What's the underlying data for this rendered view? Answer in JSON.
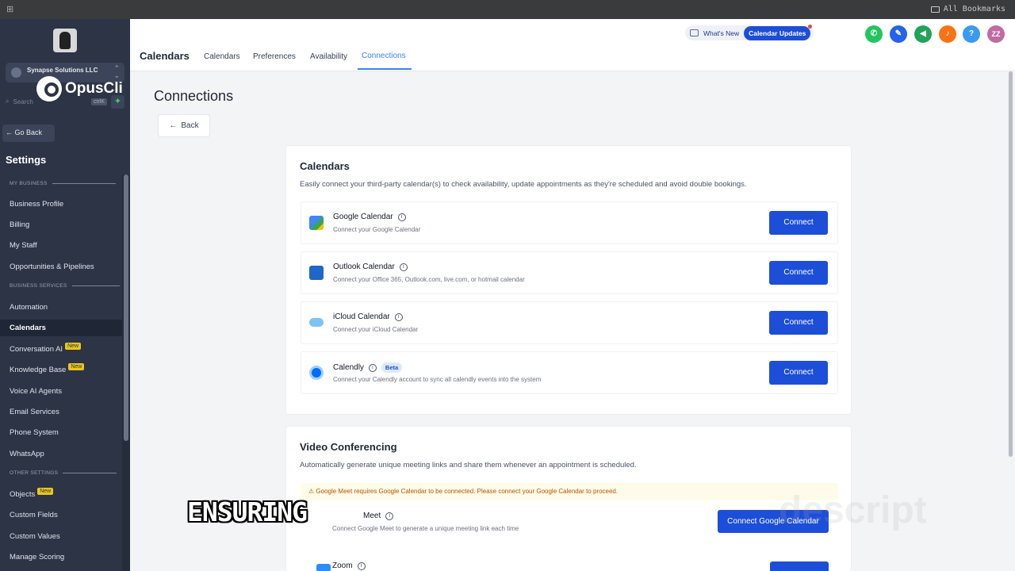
{
  "browser": {
    "bookmarks_label": "All Bookmarks"
  },
  "sidebar": {
    "account_name": "Synapse Solutions LLC",
    "overlay_brand": "OpusCli",
    "search_placeholder": "Search",
    "search_shortcut": "ctrlK",
    "go_back": "Go Back",
    "settings_title": "Settings",
    "sections": {
      "my_business": "MY BUSINESS",
      "business_services": "BUSINESS SERVICES",
      "other_settings": "OTHER SETTINGS"
    },
    "items": [
      {
        "label": "Business Profile"
      },
      {
        "label": "Billing"
      },
      {
        "label": "My Staff"
      },
      {
        "label": "Opportunities & Pipelines"
      },
      {
        "label": "Automation"
      },
      {
        "label": "Calendars"
      },
      {
        "label": "Conversation AI",
        "badge": "New"
      },
      {
        "label": "Knowledge Base",
        "badge": "New"
      },
      {
        "label": "Voice AI Agents"
      },
      {
        "label": "Email Services"
      },
      {
        "label": "Phone System"
      },
      {
        "label": "WhatsApp"
      },
      {
        "label": "Objects",
        "badge": "New"
      },
      {
        "label": "Custom Fields"
      },
      {
        "label": "Custom Values"
      },
      {
        "label": "Manage Scoring"
      }
    ]
  },
  "topbar": {
    "title": "Calendars",
    "tabs": [
      "Calendars",
      "Preferences",
      "Availability",
      "Connections"
    ],
    "active_tab": "Connections",
    "whats_new": "What's New",
    "calendar_updates": "Calendar Updates",
    "user_initials": "ZZ",
    "help": "?"
  },
  "main": {
    "title": "Connections",
    "back": "Back",
    "calendars_card": {
      "title": "Calendars",
      "description": "Easily connect your third-party calendar(s) to check availability, update appointments as they're scheduled and avoid double bookings.",
      "rows": [
        {
          "name": "Google Calendar",
          "description": "Connect your Google Calendar",
          "button": "Connect"
        },
        {
          "name": "Outlook Calendar",
          "description": "Connect your Office 365, Outlook.com, live.com, or hotmail calendar",
          "button": "Connect"
        },
        {
          "name": "iCloud Calendar",
          "description": "Connect your iCloud Calendar",
          "button": "Connect"
        },
        {
          "name": "Calendly",
          "badge": "Beta",
          "description": "Connect your Calendly account to sync all calendly events into the system",
          "button": "Connect"
        }
      ]
    },
    "video_card": {
      "title": "Video Conferencing",
      "description": "Automatically generate unique meeting links and share them whenever an appointment is scheduled.",
      "warning": "Google Meet requires Google Calendar to be connected. Please connect your Google Calendar to proceed.",
      "meet_name": "Meet",
      "meet_description": "Connect Google Meet to generate a unique meeting link each time",
      "meet_button": "Connect Google Calendar",
      "zoom_name": "Zoom"
    }
  },
  "overlay": {
    "caption": "ENSURING",
    "watermark": "descript"
  }
}
